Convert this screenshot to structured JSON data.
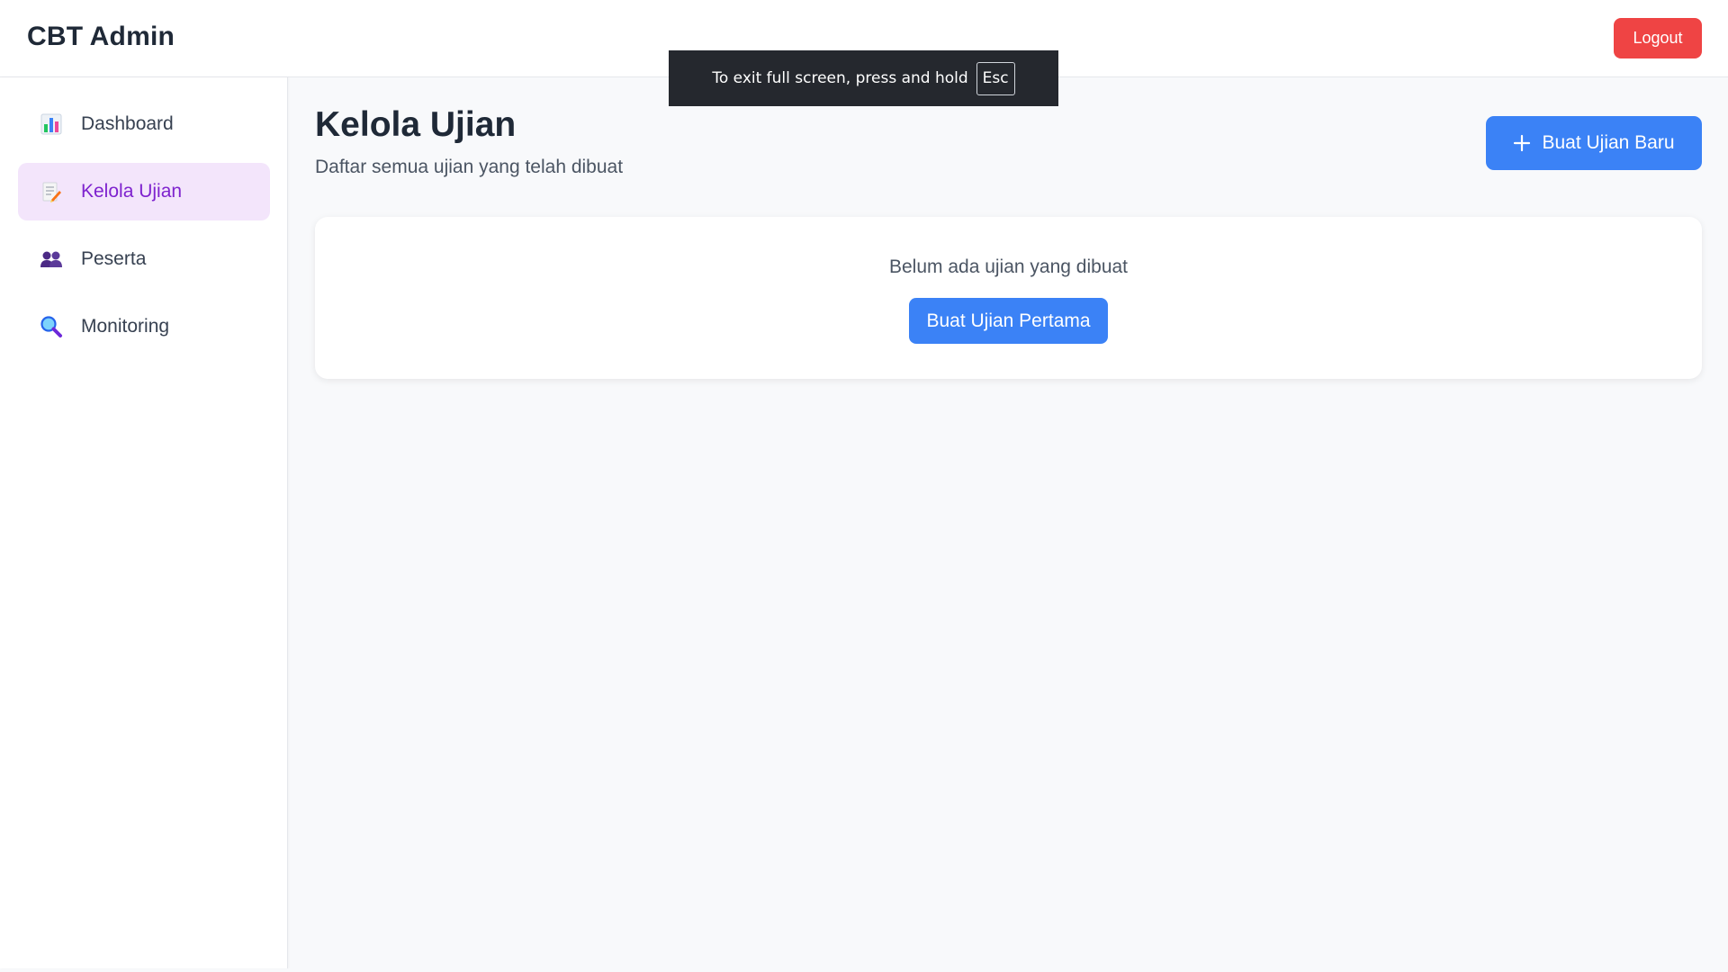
{
  "header": {
    "brand": "CBT Admin",
    "logout_label": "Logout"
  },
  "fullscreen_toast": {
    "message": "To exit full screen, press and hold",
    "key": "Esc"
  },
  "sidebar": {
    "items": [
      {
        "label": "Dashboard",
        "icon": "bar-chart-icon",
        "active": false
      },
      {
        "label": "Kelola Ujian",
        "icon": "memo-icon",
        "active": true
      },
      {
        "label": "Peserta",
        "icon": "users-icon",
        "active": false
      },
      {
        "label": "Monitoring",
        "icon": "magnifier-icon",
        "active": false
      }
    ]
  },
  "main": {
    "title": "Kelola Ujian",
    "subtitle": "Daftar semua ujian yang telah dibuat",
    "create_label": "Buat Ujian Baru",
    "empty_state": {
      "message": "Belum ada ujian yang dibuat",
      "button_label": "Buat Ujian Pertama"
    }
  },
  "colors": {
    "primary": "#3b82f6",
    "danger": "#ef4444",
    "active_bg": "#f3e5fb",
    "active_text": "#7e22ce"
  }
}
